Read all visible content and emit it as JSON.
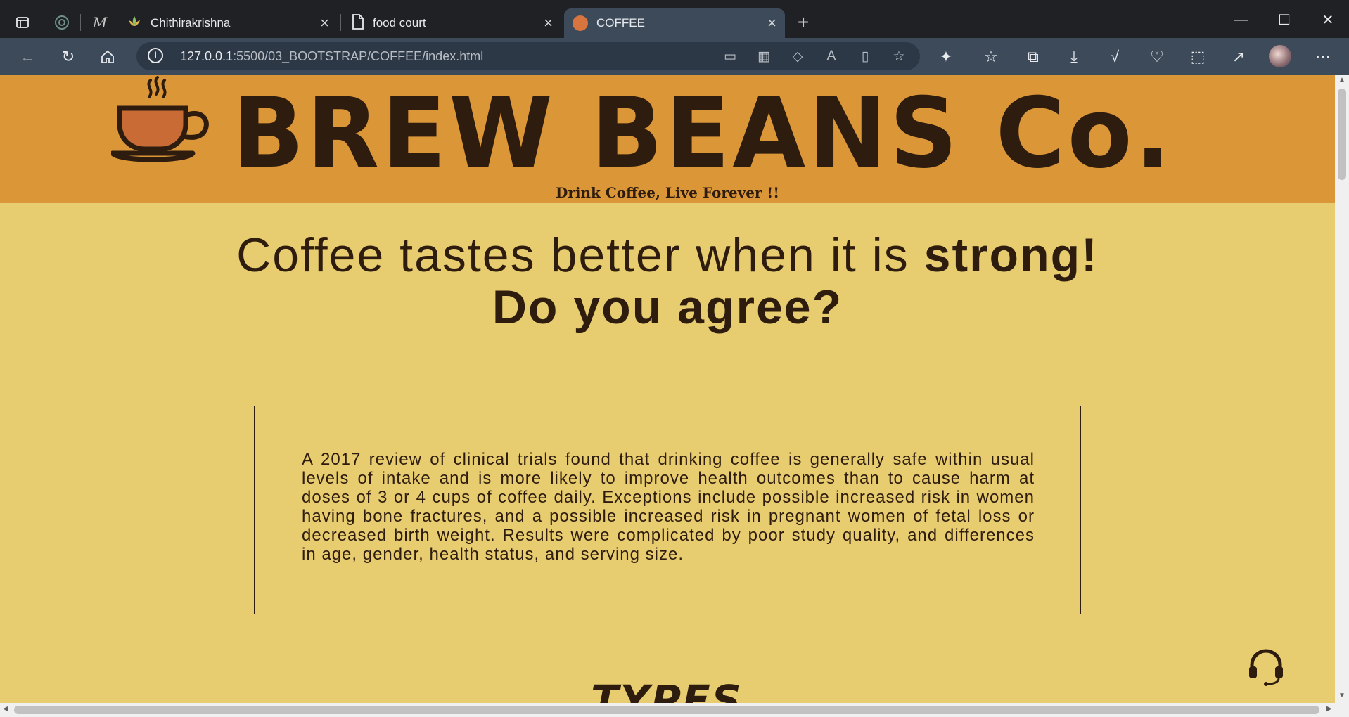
{
  "browser": {
    "tabs": [
      {
        "title": "Chithirakrishna",
        "icon": "lotus-icon"
      },
      {
        "title": "food court",
        "icon": "page-icon"
      },
      {
        "title": "COFFEE",
        "icon": "coffee-favicon",
        "active": true
      }
    ],
    "url_host": "127.0.0.1",
    "url_rest": ":5500/03_BOOTSTRAP/COFFEE/index.html"
  },
  "page": {
    "brand": "BREW BEANS Co.",
    "tagline": "Drink Coffee, Live Forever !!",
    "headline_line1_normal": "Coffee tastes better when it is ",
    "headline_line1_bold": "strong!",
    "headline_line2": "Do you agree?",
    "info_text": "A 2017 review of clinical trials found that drinking coffee is generally safe within usual levels of intake and is more likely to improve health outcomes than to cause harm at doses of 3 or 4 cups of coffee daily. Exceptions include possible increased risk in women having bone fractures, and a possible increased risk in pregnant women of fetal loss or decreased birth weight. Results were complicated by poor study quality, and differences in age, gender, health status, and serving size.",
    "types_heading": "TYPES"
  },
  "colors": {
    "header_bg": "#db9638",
    "page_bg": "#e8cd70",
    "text_dark": "#2e1c0f",
    "cup_fill": "#c86b35"
  }
}
